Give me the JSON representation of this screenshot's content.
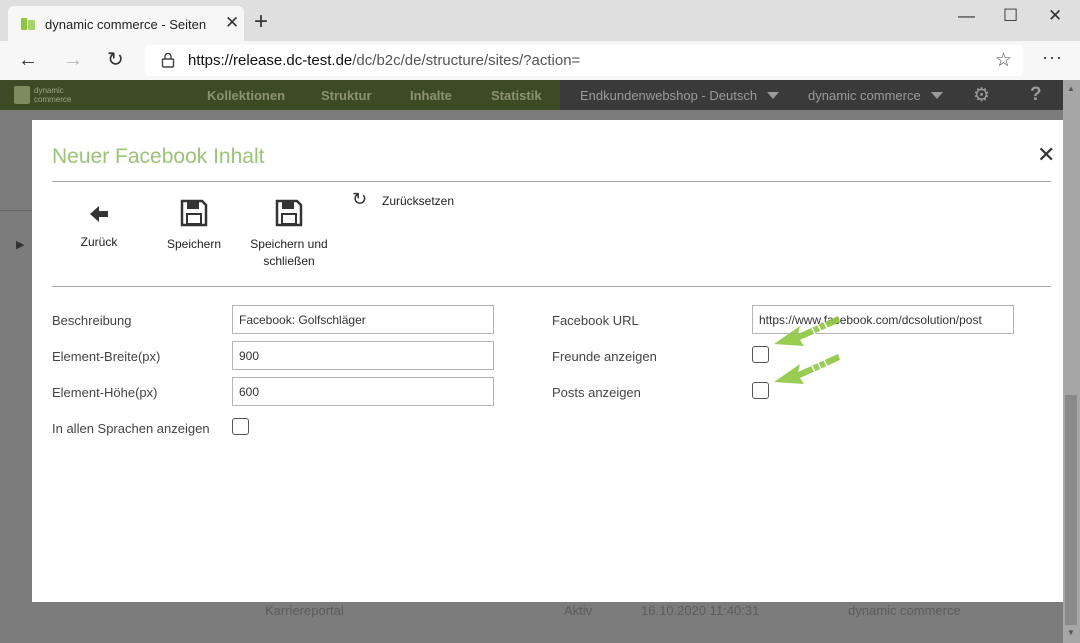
{
  "browser": {
    "tab_title": "dynamic commerce - Seiten",
    "tab_close": "✕",
    "new_tab": "+",
    "minimize": "—",
    "maximize": "☐",
    "close": "✕",
    "url_host": "https://release.dc-test.de",
    "url_path": "/dc/b2c/de/structure/sites/?action=",
    "back": "←",
    "forward": "→",
    "refresh": "↻",
    "favorite": "☆",
    "more": "···"
  },
  "app_header": {
    "logo_line1": "dynamic",
    "logo_line2": "commerce",
    "nav": [
      "Kollektionen",
      "Struktur",
      "Inhalte",
      "Statistik"
    ],
    "shop_select": "Endkundenwebshop - Deutsch",
    "company_select": "dynamic commerce",
    "settings_icon": "⚙",
    "help_icon": "?"
  },
  "background_row": {
    "name": "Karriereportal",
    "status": "Aktiv",
    "date": "16.10.2020 11:40:31",
    "company": "dynamic commerce"
  },
  "modal": {
    "title": "Neuer Facebook Inhalt",
    "close": "✕",
    "toolbar": {
      "back_label": "Zurück",
      "save_label": "Speichern",
      "save_close_line1": "Speichern und",
      "save_close_line2": "schließen",
      "reset_label": "Zurücksetzen",
      "reset_icon": "↻"
    },
    "form": {
      "description_label": "Beschreibung",
      "description_value": "Facebook: Golfschläger",
      "width_label": "Element-Breite(px)",
      "width_value": "900",
      "height_label": "Element-Höhe(px)",
      "height_value": "600",
      "all_languages_label": "In allen Sprachen anzeigen",
      "facebook_url_label": "Facebook URL",
      "facebook_url_value": "https://www.facebook.com/dcsolution/post",
      "show_friends_label": "Freunde anzeigen",
      "show_posts_label": "Posts anzeigen"
    }
  },
  "colors": {
    "title_green": "#9cc377",
    "arrow_green": "#8dc63f"
  }
}
